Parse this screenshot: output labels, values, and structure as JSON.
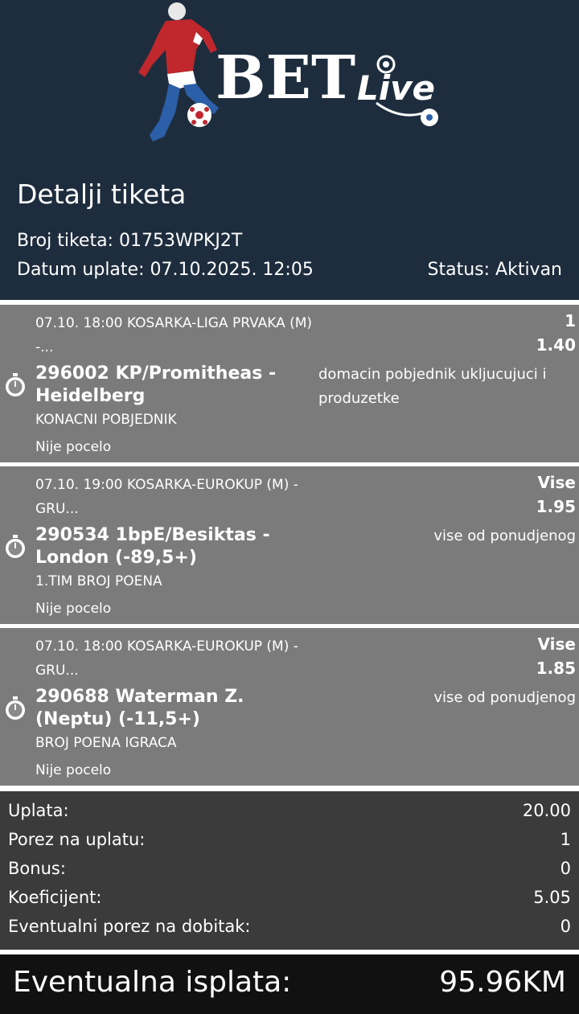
{
  "header": {
    "logo_text": "BET Live",
    "title": "Detalji tiketa",
    "ticket_number": "Broj tiketa: 01753WPKJ2T",
    "payment_date": "Datum uplate: 07.10.2025. 12:05",
    "status": "Status: Aktivan",
    "colors": {
      "background": "#1e2d3e"
    }
  },
  "matches": [
    {
      "info": "07.10. 18:00 KOSARKA-LIGA PRVAKA (M) -...",
      "pick": "1",
      "odd": "1.40",
      "name": "296002 KP/Promitheas - Heidelberg",
      "description": "domacin pobjednik ukljucujuci i produzetke",
      "market": "KONACNI POBJEDNIK",
      "state": "Nije pocelo",
      "icon": "stopwatch-icon"
    },
    {
      "info": "07.10. 19:00 KOSARKA-EUROKUP (M) - GRU...",
      "pick": "Vise",
      "odd": "1.95",
      "name": "290534 1bpE/Besiktas - London (-89,5+)",
      "description": "vise od ponudjenog",
      "market": "1.TIM BROJ POENA",
      "state": "Nije pocelo",
      "icon": "stopwatch-icon"
    },
    {
      "info": "07.10. 18:00 KOSARKA-EUROKUP (M) - GRU...",
      "pick": "Vise",
      "odd": "1.85",
      "name": "290688 Waterman Z.(Neptu) (-11,5+)",
      "description": "vise od ponudjenog",
      "market": "BROJ POENA IGRACA",
      "state": "Nije pocelo",
      "icon": "stopwatch-icon"
    }
  ],
  "summary": {
    "rows": [
      {
        "label": "Uplata:",
        "value": "20.00"
      },
      {
        "label": "Porez na uplatu:",
        "value": "1"
      },
      {
        "label": "Bonus:",
        "value": "0"
      },
      {
        "label": "Koeficijent:",
        "value": "5.05"
      },
      {
        "label": "Eventualni porez na dobitak:",
        "value": "0"
      }
    ]
  },
  "payout": {
    "label": "Eventualna isplata:",
    "value": "95.96KM"
  }
}
